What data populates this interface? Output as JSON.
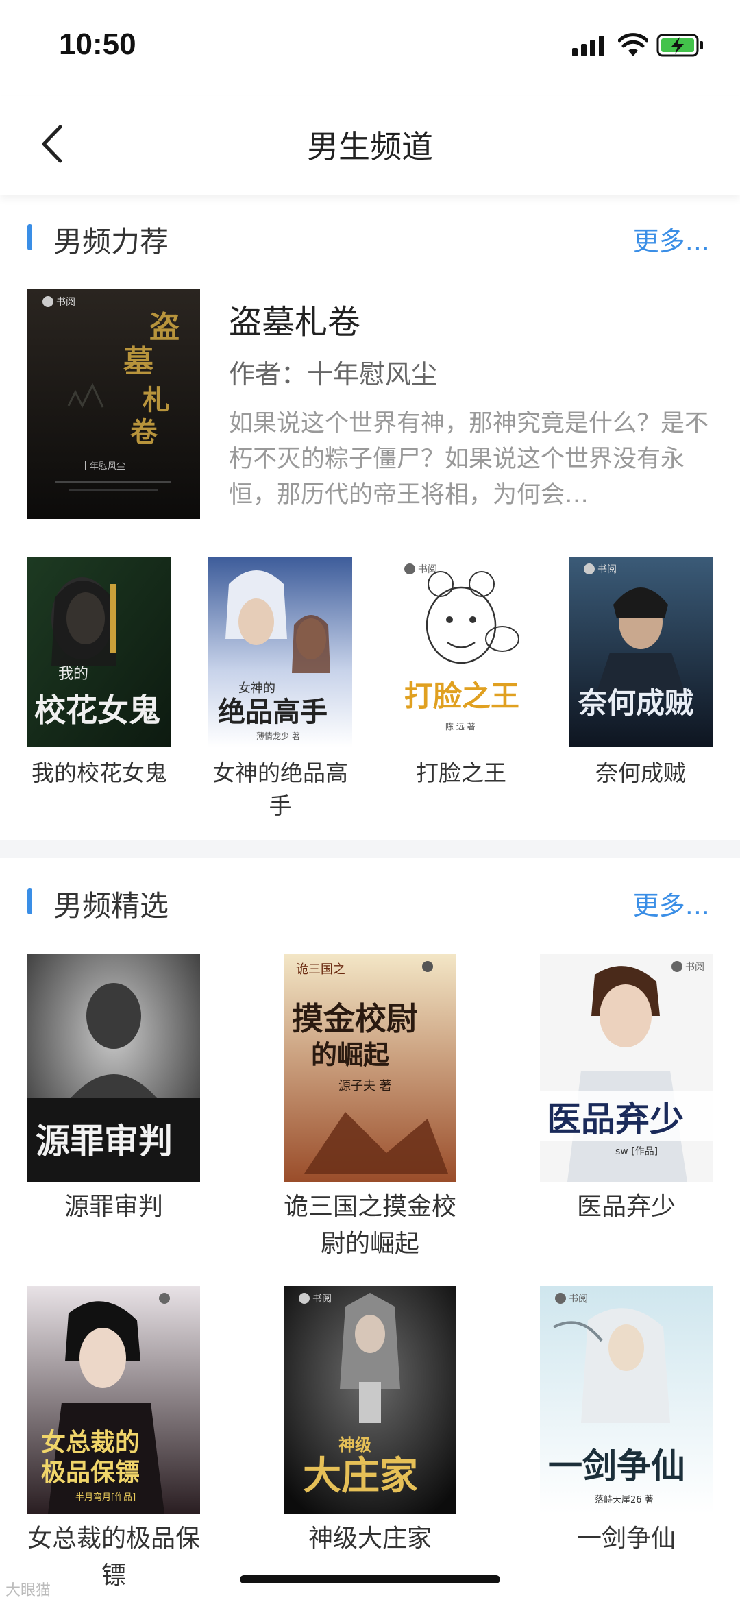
{
  "status": {
    "time": "10:50"
  },
  "nav": {
    "title": "男生频道"
  },
  "sections": [
    {
      "title": "男频力荐",
      "more": "更多..."
    },
    {
      "title": "男频精选",
      "more": "更多..."
    }
  ],
  "featured": {
    "title": "盗墓札卷",
    "author": "作者：十年慰风尘",
    "description": "如果说这个世界有神，那神究竟是什么？是不朽不灭的粽子僵尸？如果说这个世界没有永恒，那历代的帝王将相，为何会…",
    "cover_text": "盗墓札卷"
  },
  "row_books": [
    {
      "name": "我的校花女鬼",
      "cover_text": "我的校花女鬼"
    },
    {
      "name": "女神的绝品高手",
      "cover_text": "绝品高手"
    },
    {
      "name": "打脸之王",
      "cover_text": "打脸之王"
    },
    {
      "name": "奈何成贼",
      "cover_text": "奈何成贼"
    }
  ],
  "grid_books": [
    {
      "name": "源罪审判",
      "cover_text": "源罪审判"
    },
    {
      "name": "诡三国之摸金校尉的崛起",
      "cover_text": "摸金校尉的崛起"
    },
    {
      "name": "医品弃少",
      "cover_text": "医品弃少"
    },
    {
      "name": "女总裁的极品保镖",
      "cover_text": "女总裁的极品保镖"
    },
    {
      "name": "神级大庄家",
      "cover_text": "大庄家"
    },
    {
      "name": "一剑争仙",
      "cover_text": "一剑争仙"
    }
  ],
  "watermark": "大眼猫",
  "colors": {
    "accent": "#3a8ee6",
    "divider": "#f4f5f7"
  }
}
